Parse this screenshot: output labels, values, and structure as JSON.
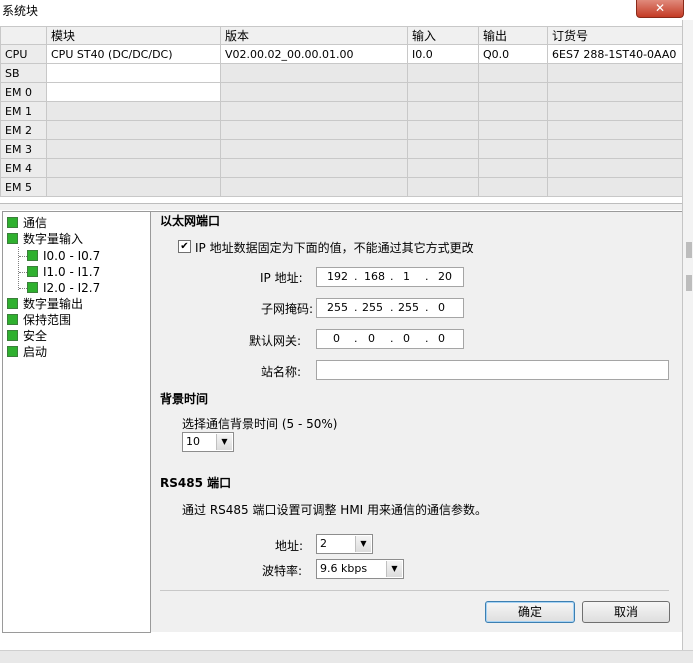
{
  "window": {
    "title": "系统块",
    "close_glyph": "✕"
  },
  "grid": {
    "columns": [
      "",
      "模块",
      "版本",
      "输入",
      "输出",
      "订货号"
    ],
    "rows": [
      [
        "CPU",
        "CPU ST40 (DC/DC/DC)",
        "V02.00.02_00.00.01.00",
        "I0.0",
        "Q0.0",
        "6ES7 288-1ST40-0AA0"
      ],
      [
        "SB",
        "",
        "",
        "",
        "",
        ""
      ],
      [
        "EM 0",
        "",
        "",
        "",
        "",
        ""
      ],
      [
        "EM 1",
        "",
        "",
        "",
        "",
        ""
      ],
      [
        "EM 2",
        "",
        "",
        "",
        "",
        ""
      ],
      [
        "EM 3",
        "",
        "",
        "",
        "",
        ""
      ],
      [
        "EM 4",
        "",
        "",
        "",
        "",
        ""
      ],
      [
        "EM 5",
        "",
        "",
        "",
        "",
        ""
      ]
    ]
  },
  "tree": {
    "items": [
      {
        "label": "通信",
        "level": 0,
        "selected": true
      },
      {
        "label": "数字量输入",
        "level": 0
      },
      {
        "label": "I0.0 - I0.7",
        "level": 1
      },
      {
        "label": "I1.0 - I1.7",
        "level": 1
      },
      {
        "label": "I2.0 - I2.7",
        "level": 1
      },
      {
        "label": "数字量输出",
        "level": 0
      },
      {
        "label": "保持范围",
        "level": 0
      },
      {
        "label": "安全",
        "level": 0
      },
      {
        "label": "启动",
        "level": 0
      }
    ]
  },
  "ethernet": {
    "heading": "以太网端口",
    "fixed_ip_checkbox": {
      "checked": true,
      "label": "IP 地址数据固定为下面的值，不能通过其它方式更改"
    },
    "ip_label": "IP 地址:",
    "ip": [
      "192",
      "168",
      "1",
      "20"
    ],
    "subnet_label": "子网掩码:",
    "subnet": [
      "255",
      "255",
      "255",
      "0"
    ],
    "gateway_label": "默认网关:",
    "gateway": [
      "0",
      "0",
      "0",
      "0"
    ],
    "station_label": "站名称:",
    "station_value": ""
  },
  "background": {
    "heading": "背景时间",
    "select_label": "选择通信背景时间 (5 - 50%)",
    "value": "10"
  },
  "rs485": {
    "heading": "RS485 端口",
    "description": "通过 RS485 端口设置可调整 HMI 用来通信的通信参数。",
    "address_label": "地址:",
    "address_value": "2",
    "baud_label": "波特率:",
    "baud_value": "9.6 kbps"
  },
  "buttons": {
    "ok": "确定",
    "cancel": "取消"
  },
  "colors": {
    "node_icon": "#2fb02f",
    "close_button": "#c43b25"
  }
}
